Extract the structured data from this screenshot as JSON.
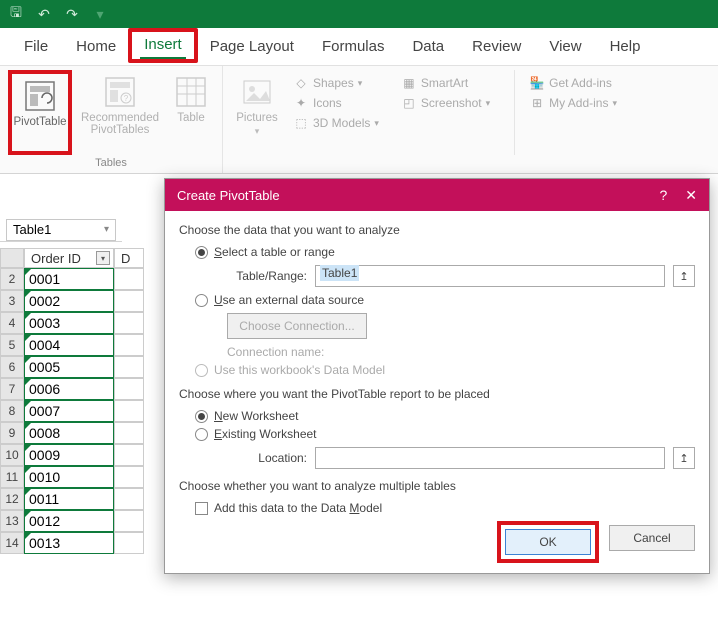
{
  "titlebar": {
    "icons": [
      "save",
      "undo",
      "redo"
    ]
  },
  "tabs": {
    "file": "File",
    "home": "Home",
    "insert": "Insert",
    "pagelayout": "Page Layout",
    "formulas": "Formulas",
    "data": "Data",
    "review": "Review",
    "view": "View",
    "help": "Help"
  },
  "ribbon": {
    "tables": {
      "pivottable": "PivotTable",
      "recommended": "Recommended PivotTables",
      "table": "Table",
      "group_label": "Tables"
    },
    "illustrations": {
      "pictures": "Pictures",
      "shapes": "Shapes",
      "icons": "Icons",
      "models": "3D Models",
      "smartart": "SmartArt",
      "screenshot": "Screenshot"
    },
    "addins": {
      "get": "Get Add-ins",
      "my": "My Add-ins"
    }
  },
  "namebox": "Table1",
  "grid": {
    "col_header": "Order ID",
    "col2_header": "D",
    "rows": [
      {
        "n": "2",
        "v": "0001"
      },
      {
        "n": "3",
        "v": "0002"
      },
      {
        "n": "4",
        "v": "0003"
      },
      {
        "n": "5",
        "v": "0004"
      },
      {
        "n": "6",
        "v": "0005"
      },
      {
        "n": "7",
        "v": "0006"
      },
      {
        "n": "8",
        "v": "0007"
      },
      {
        "n": "9",
        "v": "0008"
      },
      {
        "n": "10",
        "v": "0009"
      },
      {
        "n": "11",
        "v": "0010"
      },
      {
        "n": "12",
        "v": "0011"
      },
      {
        "n": "13",
        "v": "0012"
      },
      {
        "n": "14",
        "v": "0013"
      }
    ]
  },
  "dialog": {
    "title": "Create PivotTable",
    "help": "?",
    "close": "✕",
    "sect1": "Choose the data that you want to analyze",
    "opt_select": "elect a table or range",
    "opt_select_prefix": "S",
    "tr_label_prefix": "T",
    "tr_label": "able/Range:",
    "tr_value": "Table1",
    "opt_external_prefix": "U",
    "opt_external": "se an external data source",
    "choose_conn": "Choose Connection...",
    "conn_name": "Connection name:",
    "opt_model": "Use this workbook's Data Model",
    "sect2": "Choose where you want the PivotTable report to be placed",
    "opt_new_prefix": "N",
    "opt_new": "ew Worksheet",
    "opt_existing_prefix": "E",
    "opt_existing": "xisting Worksheet",
    "loc_label_prefix": "L",
    "loc_label": "ocation:",
    "sect3": "Choose whether you want to analyze multiple tables",
    "opt_add_prefix": "M",
    "opt_add": "Add this data to the Data ",
    "opt_add_suffix": "odel",
    "ok": "OK",
    "cancel": "Cancel"
  }
}
